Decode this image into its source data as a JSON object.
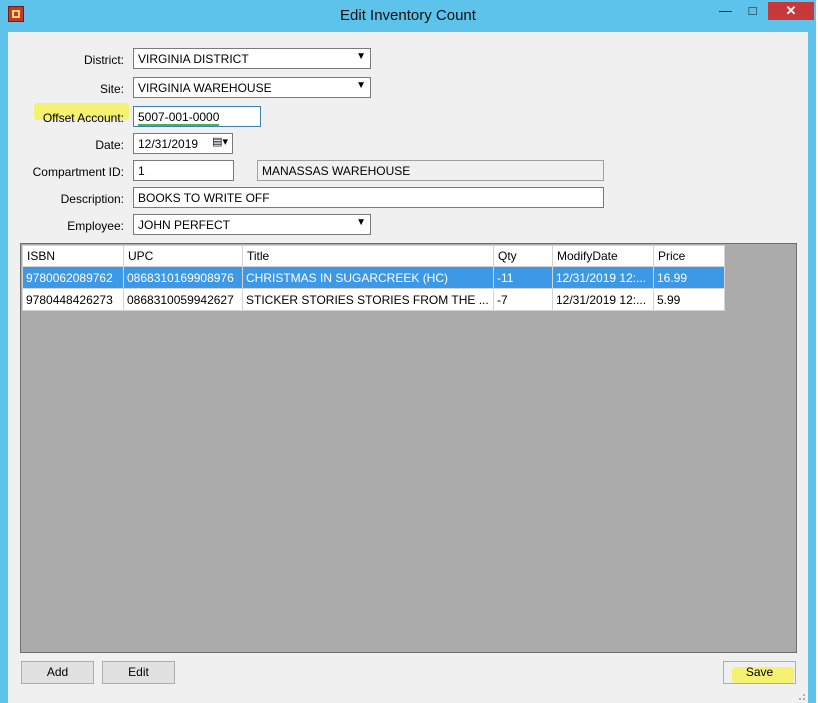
{
  "window": {
    "title": "Edit Inventory Count",
    "controls": {
      "minimize": "—",
      "maximize": "□",
      "close": "✕"
    },
    "icon": "app-icon"
  },
  "form": {
    "district": {
      "label": "District:",
      "value": "VIRGINIA DISTRICT"
    },
    "site": {
      "label": "Site:",
      "value": "VIRGINIA WAREHOUSE"
    },
    "offset_account": {
      "label": "Offset Account:",
      "value": "5007-001-0000"
    },
    "date": {
      "label": "Date:",
      "value": "12/31/2019"
    },
    "compartment": {
      "label": "Compartment ID:",
      "value": "1",
      "name": "MANASSAS WAREHOUSE"
    },
    "description": {
      "label": "Description:",
      "value": "BOOKS TO WRITE OFF"
    },
    "employee": {
      "label": "Employee:",
      "value": "JOHN PERFECT"
    }
  },
  "grid": {
    "columns": [
      "ISBN",
      "UPC",
      "Title",
      "Qty",
      "ModifyDate",
      "Price"
    ],
    "rows": [
      [
        "9780062089762",
        "0868310169908976",
        "CHRISTMAS IN SUGARCREEK (HC)",
        "-11",
        "12/31/2019 12:...",
        "16.99"
      ],
      [
        "9780448426273",
        "0868310059942627",
        "STICKER STORIES STORIES FROM THE ...",
        "-7",
        "12/31/2019 12:...",
        "5.99"
      ]
    ],
    "selected_row": 0
  },
  "buttons": {
    "add": "Add",
    "edit": "Edit",
    "save": "Save"
  },
  "colors": {
    "titlebar": "#5ec3ea",
    "selection": "#3d98e6",
    "highlight": "#f6f25a",
    "close": "#c7383b"
  }
}
